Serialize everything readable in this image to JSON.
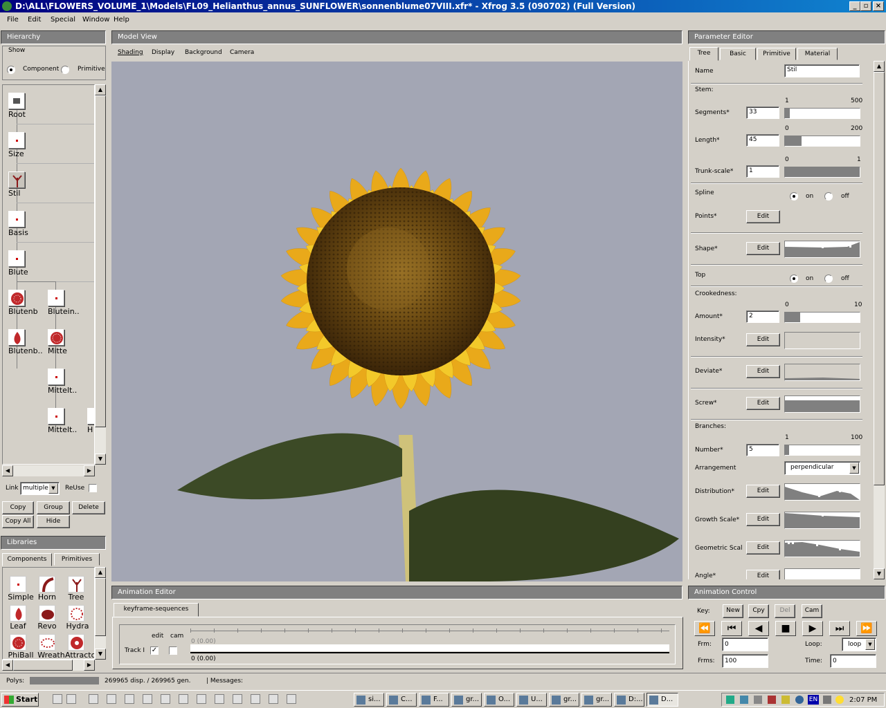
{
  "window": {
    "title": "D:\\ALL\\FLOWERS_VOLUME_1\\Models\\FL09_Helianthus_annus_SUNFLOWER\\sonnenblume07VIII.xfr* - Xfrog 3.5 (090702) (Full Version)",
    "min": "_",
    "max": "▫",
    "close": "×"
  },
  "menu": {
    "file": "File",
    "edit": "Edit",
    "special": "Special",
    "window": "Window",
    "help": "Help"
  },
  "hierarchy": {
    "title": "Hierarchy",
    "show": "Show",
    "component": "Component",
    "primitive": "Primitive",
    "nodes": [
      "Root",
      "Size",
      "Stil",
      "Basis",
      "Blute",
      "Blutenb",
      "Blutein..",
      "Blutenb..",
      "Mitte",
      "Mittelt..",
      "Mittelt..",
      "H"
    ],
    "link_label": "Link",
    "link_value": "multiple",
    "reuse": "ReUse",
    "copy": "Copy",
    "group": "Group",
    "delete": "Delete",
    "copy_all": "Copy All",
    "hide": "Hide"
  },
  "libraries": {
    "title": "Libraries",
    "tab_components": "Components",
    "tab_primitives": "Primitives",
    "items": [
      "Simple",
      "Horn",
      "Tree",
      "Leaf",
      "Revo",
      "Hydra",
      "PhiBall",
      "Wreath",
      "Attractor"
    ]
  },
  "model_view": {
    "title": "Model View",
    "menu": [
      "Shading",
      "Display",
      "Background",
      "Camera"
    ],
    "background": "#a3a6b4"
  },
  "parameter_editor": {
    "title": "Parameter Editor",
    "tabs": [
      "Tree",
      "Basic",
      "Primitive",
      "Material"
    ],
    "name_label": "Name",
    "name_value": "Stil",
    "stem": "Stem:",
    "seg_min": "1",
    "seg_max": "500",
    "segments_label": "Segments*",
    "segments_value": "33",
    "segments_fraction": 0.066,
    "len_min": "0",
    "len_max": "200",
    "length_label": "Length*",
    "length_value": "45",
    "length_fraction": 0.225,
    "trunk_min": "0",
    "trunk_max": "1",
    "trunk_label": "Trunk-scale*",
    "trunk_value": "1",
    "trunk_fraction": 1.0,
    "spline": "Spline",
    "on": "on",
    "off": "off",
    "points": "Points*",
    "edit": "Edit",
    "shape": "Shape*",
    "top": "Top",
    "crookedness": "Crookedness:",
    "amt_min": "0",
    "amt_max": "10",
    "amount_label": "Amount*",
    "amount_value": "2",
    "amount_fraction": 0.2,
    "intensity": "Intensity*",
    "deviate": "Deviate*",
    "screw": "Screw*",
    "branches": "Branches:",
    "num_min": "1",
    "num_max": "100",
    "number_label": "Number*",
    "number_value": "5",
    "number_fraction": 0.04,
    "arrangement_label": "Arrangement",
    "arrangement_value": "perpendicular",
    "distribution": "Distribution*",
    "growth": "Growth Scale*",
    "geometric": "Geometric Scal",
    "angle": "Angle*"
  },
  "animation_editor": {
    "title": "Animation Editor",
    "tab": "keyframe-sequences",
    "edit": "edit",
    "cam": "cam",
    "track": "Track I",
    "t1": "0 (0.00)",
    "t2": "0 (0.00)"
  },
  "animation_control": {
    "title": "Animation Control",
    "key": "Key:",
    "new": "New",
    "cpy": "Cpy",
    "del": "Del",
    "cam": "Cam",
    "frm_label": "Frm:",
    "frm_value": "0",
    "frms_label": "Frms:",
    "frms_value": "100",
    "loop_label": "Loop:",
    "loop_value": "loop",
    "time_label": "Time:",
    "time_value": "0"
  },
  "status": {
    "polys": "Polys:",
    "counts": "269965 disp. / 269965 gen.",
    "messages": "| Messages:"
  },
  "taskbar": {
    "start": "Start",
    "items": [
      "si...",
      "C...",
      "F...",
      "gr...",
      "O...",
      "U...",
      "gr...",
      "gr...",
      "D:...",
      "D..."
    ],
    "lang": "EN",
    "time": "2:07 PM"
  }
}
